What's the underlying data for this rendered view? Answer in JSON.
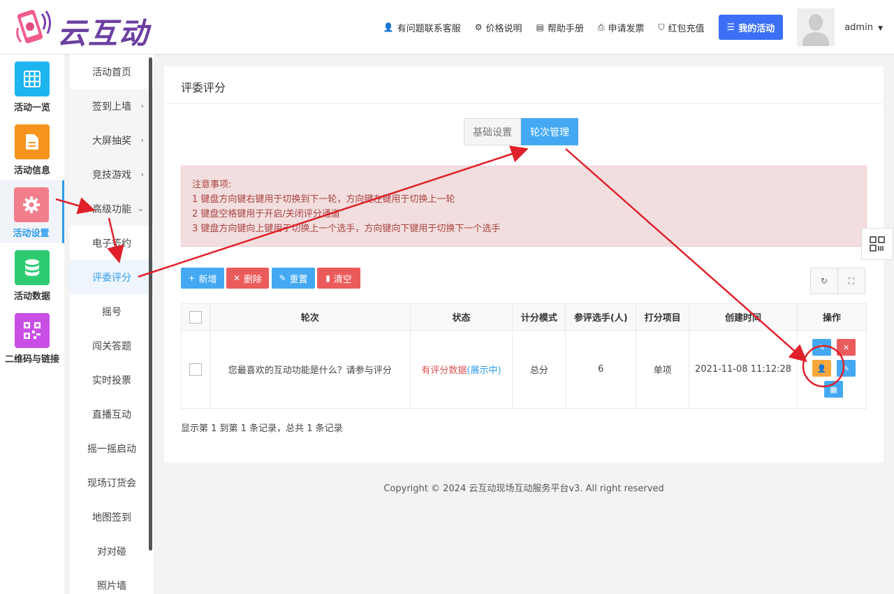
{
  "brand": {
    "name": "云互动"
  },
  "header": {
    "nav": [
      {
        "label": "有问题联系客服",
        "icon": "user-plus-icon"
      },
      {
        "label": "价格说明",
        "icon": "gear-icon"
      },
      {
        "label": "帮助手册",
        "icon": "book-icon"
      },
      {
        "label": "申请发票",
        "icon": "printer-icon"
      },
      {
        "label": "红包充值",
        "icon": "shield-check-icon"
      }
    ],
    "my_activity": "我的活动",
    "user": "admin"
  },
  "sidebar": {
    "items": [
      {
        "label": "活动一览",
        "icon": "grid-icon",
        "color": "#1db4f0"
      },
      {
        "label": "活动信息",
        "icon": "document-icon",
        "color": "#f7941d"
      },
      {
        "label": "活动设置",
        "icon": "gear-icon",
        "color": "#f27e8c",
        "active": true
      },
      {
        "label": "活动数据",
        "icon": "database-icon",
        "color": "#2ecc71"
      },
      {
        "label": "二维码与链接",
        "icon": "qrcode-icon",
        "color": "#c84ee6"
      }
    ]
  },
  "submenu": {
    "items": [
      {
        "label": "活动首页"
      },
      {
        "label": "签到上墙",
        "arrow": "›"
      },
      {
        "label": "大屏抽奖",
        "arrow": "›"
      },
      {
        "label": "竞技游戏",
        "arrow": "›"
      },
      {
        "label": "高级功能",
        "arrow": "⌄"
      },
      {
        "label": "电子签约"
      },
      {
        "label": "评委评分",
        "active": true
      },
      {
        "label": "摇号"
      },
      {
        "label": "闯关答题"
      },
      {
        "label": "实时投票"
      },
      {
        "label": "直播互动"
      },
      {
        "label": "摇一摇启动"
      },
      {
        "label": "现场订货会"
      },
      {
        "label": "地图签到"
      },
      {
        "label": "对对碰"
      },
      {
        "label": "照片墙"
      }
    ]
  },
  "main": {
    "title": "评委评分",
    "tabs": [
      {
        "label": "基础设置"
      },
      {
        "label": "轮次管理",
        "active": true
      }
    ],
    "notice": [
      "注意事项:",
      "1 键盘方向键右键用于切换到下一轮，方向键左键用于切换上一轮",
      "2 键盘空格键用于开启/关闭评分通道",
      "3 键盘方向键向上键用于切换上一个选手，方向键向下键用于切换下一个选手"
    ],
    "toolbar": {
      "add": "新增",
      "delete": "删除",
      "reset": "重置",
      "clear": "清空"
    },
    "table": {
      "headers": [
        "轮次",
        "状态",
        "计分模式",
        "参评选手(人)",
        "打分项目",
        "创建时间",
        "操作"
      ],
      "rows": [
        {
          "round": "您最喜欢的互动功能是什么？请参与评分",
          "status_a": "有评分数据",
          "status_b": "(展示中)",
          "mode": "总分",
          "players": "6",
          "items": "单项",
          "created": "2021-11-08 11:12:28"
        }
      ]
    },
    "record_summary": "显示第 1 到第 1 条记录，总共 1 条记录"
  },
  "footer": {
    "copyright": "Copyright © 2024 云互动现场互动服务平台v3. All right reserved"
  },
  "colors": {
    "accent": "#44a9f2",
    "danger": "#ec5b5b",
    "warning": "#f7a73b",
    "primary": "#3c6ff5",
    "annotation": "#e0202a"
  }
}
